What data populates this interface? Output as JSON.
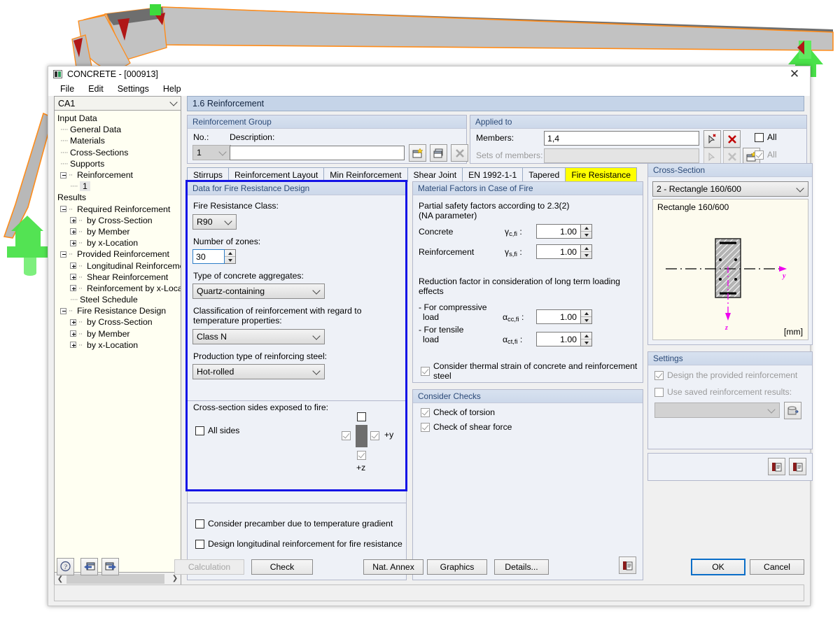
{
  "window": {
    "title": "CONCRETE - [000913]",
    "app_icon": "concrete-app-icon",
    "close_label": "✕",
    "menu": [
      "File",
      "Edit",
      "Settings",
      "Help"
    ]
  },
  "navigator": {
    "combo_value": "CA1",
    "tree": [
      {
        "label": "Input Data",
        "level": 0,
        "marker": "none"
      },
      {
        "label": "General Data",
        "level": 1,
        "marker": "dash"
      },
      {
        "label": "Materials",
        "level": 1,
        "marker": "dash"
      },
      {
        "label": "Cross-Sections",
        "level": 1,
        "marker": "dash"
      },
      {
        "label": "Supports",
        "level": 1,
        "marker": "dash"
      },
      {
        "label": "Reinforcement",
        "level": 1,
        "marker": "minus"
      },
      {
        "label": "1",
        "level": 2,
        "marker": "dash",
        "selected": true
      },
      {
        "label": "Results",
        "level": 0,
        "marker": "none"
      },
      {
        "label": "Required Reinforcement",
        "level": 1,
        "marker": "minus"
      },
      {
        "label": "by Cross-Section",
        "level": 2,
        "marker": "plus"
      },
      {
        "label": "by Member",
        "level": 2,
        "marker": "plus"
      },
      {
        "label": "by x-Location",
        "level": 2,
        "marker": "plus"
      },
      {
        "label": "Provided Reinforcement",
        "level": 1,
        "marker": "minus"
      },
      {
        "label": "Longitudinal Reinforcement",
        "level": 2,
        "marker": "plus"
      },
      {
        "label": "Shear Reinforcement",
        "level": 2,
        "marker": "plus"
      },
      {
        "label": "Reinforcement by x-Location",
        "level": 2,
        "marker": "plus"
      },
      {
        "label": "Steel Schedule",
        "level": 2,
        "marker": "dash"
      },
      {
        "label": "Fire Resistance Design",
        "level": 1,
        "marker": "minus"
      },
      {
        "label": "by Cross-Section",
        "level": 2,
        "marker": "plus"
      },
      {
        "label": "by Member",
        "level": 2,
        "marker": "plus"
      },
      {
        "label": "by x-Location",
        "level": 2,
        "marker": "plus"
      }
    ]
  },
  "main": {
    "section_title": "1.6 Reinforcement",
    "reinforcement_group": {
      "header": "Reinforcement Group",
      "no_label": "No.:",
      "no_value": "1",
      "description_label": "Description:",
      "description_value": "",
      "buttons": [
        "new-group-icon",
        "copy-group-icon",
        "delete-group-icon"
      ]
    },
    "applied_to": {
      "header": "Applied to",
      "members_label": "Members:",
      "members_value": "1,4",
      "sets_label": "Sets of members:",
      "sets_value": "",
      "all_label": "All",
      "all_checked": false,
      "all2_label": "All",
      "all2_checked": true
    },
    "tabs": [
      {
        "label": "Stirrups",
        "active": false
      },
      {
        "label": "Reinforcement Layout",
        "active": false
      },
      {
        "label": "Min Reinforcement",
        "active": false
      },
      {
        "label": "Shear Joint",
        "active": false
      },
      {
        "label": "EN 1992-1-1",
        "active": false
      },
      {
        "label": "Tapered",
        "active": false
      },
      {
        "label": "Fire Resistance",
        "active": true
      }
    ],
    "tab_prev": "◀",
    "tab_next": "▶"
  },
  "fire_design": {
    "header": "Data for Fire Resistance Design",
    "fire_class_label": "Fire Resistance Class:",
    "fire_class_value": "R90",
    "zones_label": "Number of zones:",
    "zones_value": "30",
    "aggregates_label": "Type of concrete aggregates:",
    "aggregates_value": "Quartz-containing",
    "classification_label_1": "Classification of reinforcement with regard to",
    "classification_label_2": "temperature properties:",
    "classification_value": "Class N",
    "production_label": "Production type of reinforcing steel:",
    "production_value": "Hot-rolled",
    "sides_label": "Cross-section sides exposed to fire:",
    "all_sides_label": "All sides",
    "all_sides_checked": false,
    "side_top_checked": false,
    "side_left_checked": true,
    "side_right_checked": true,
    "side_bottom_checked": true,
    "axis_y_label": "+y",
    "axis_z_label": "+z"
  },
  "extra_options": {
    "precamber_label": "Consider precamber due to temperature gradient",
    "precamber_checked": false,
    "longitudinal_label": "Design longitudinal reinforcement for fire resistance",
    "longitudinal_checked": false
  },
  "material_factors": {
    "header": "Material Factors in Case of Fire",
    "partial_line1": "Partial safety factors according to 2.3(2)",
    "partial_line2": "(NA parameter)",
    "concrete_label": "Concrete",
    "concrete_symbol_main": "γ",
    "concrete_symbol_sub": "c,fi",
    "concrete_colon": ":",
    "concrete_value": "1.00",
    "reinforcement_label": "Reinforcement",
    "reinforcement_symbol_main": "γ",
    "reinforcement_symbol_sub": "s,fi",
    "reinforcement_colon": ":",
    "reinforcement_value": "1.00",
    "reduction_line1": "Reduction factor in consideration of long term loading",
    "reduction_line2": "effects",
    "compressive_line1": "- For compressive",
    "compressive_line2": "load",
    "compressive_symbol_main": "α",
    "compressive_symbol_sub": "cc,fi",
    "compressive_colon": ":",
    "compressive_value": "1.00",
    "tensile_line1": "- For tensile",
    "tensile_line2": "load",
    "tensile_symbol_main": "α",
    "tensile_symbol_sub": "ct,fi",
    "tensile_colon": ":",
    "tensile_value": "1.00",
    "thermal_strain_label": "Consider thermal strain of concrete and reinforcement steel",
    "thermal_strain_checked": true
  },
  "consider_checks": {
    "header": "Consider Checks",
    "torsion_label": "Check of torsion",
    "torsion_checked": true,
    "shear_label": "Check of shear force",
    "shear_checked": true,
    "info_icon": "details-icon"
  },
  "cross_section": {
    "header": "Cross-Section",
    "combo_value": "2 - Rectangle 160/600",
    "caption": "Rectangle 160/600",
    "unit": "[mm]",
    "axis_y": "y",
    "axis_z": "z",
    "axis_color": "#ee00ee"
  },
  "settings": {
    "header": "Settings",
    "design_provided_label": "Design the provided reinforcement",
    "design_provided_checked": true,
    "use_saved_label": "Use saved reinforcement results:",
    "use_saved_checked": false,
    "saved_combo_value": "",
    "saved_button_icon": "database-icon",
    "footer_icons": [
      "details-icon",
      "details-icon"
    ]
  },
  "footer": {
    "help_icon": "help-icon",
    "prev_icon": "prev-window-icon",
    "next_icon": "next-window-icon",
    "calculation_label": "Calculation",
    "calculation_disabled": true,
    "check_label": "Check",
    "nat_annex_label": "Nat. Annex",
    "graphics_label": "Graphics",
    "details_label": "Details...",
    "ok_label": "OK",
    "cancel_label": "Cancel"
  },
  "colors": {
    "accent_blue": "#1414e6",
    "tab_active_bg": "#ffff00",
    "section_header_bg": "#c5d4e8",
    "support_green": "#36d936",
    "member_orange": "#ff8000",
    "beam_gray": "#c0c0c0"
  }
}
